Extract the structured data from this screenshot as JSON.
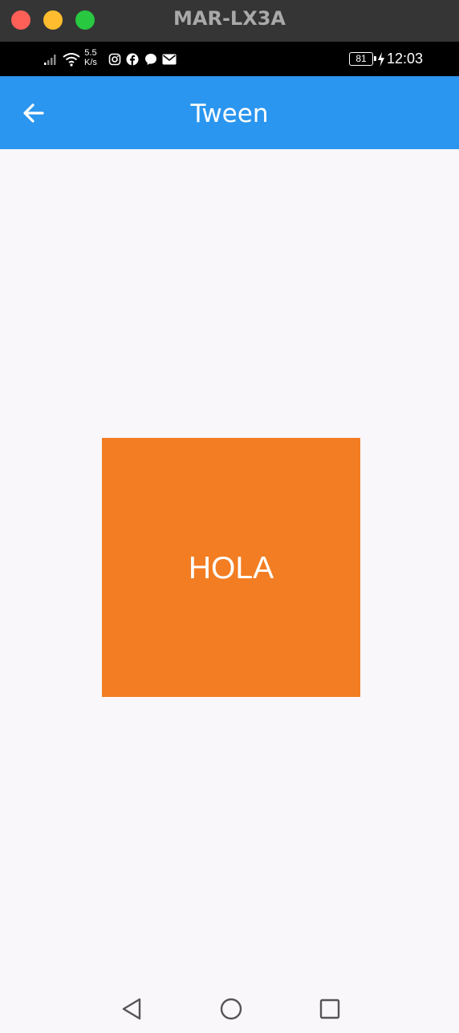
{
  "window": {
    "title": "MAR-LX3A",
    "controls": [
      "close-icon",
      "minimize-icon",
      "maximize-icon"
    ]
  },
  "status_bar": {
    "net_speed_value": "5.5",
    "net_speed_unit": "K/s",
    "battery_level": "81",
    "time": "12:03",
    "icons": [
      "signal-icon",
      "wifi-icon",
      "instagram-icon",
      "facebook-icon",
      "messenger-icon",
      "mail-icon",
      "charging-icon"
    ]
  },
  "app_bar": {
    "title": "Tween",
    "back_icon": "back-arrow-icon",
    "color": "#2b96ef"
  },
  "content": {
    "box_label": "HOLA",
    "box_color": "#f37d22"
  },
  "nav_bar": {
    "buttons": [
      "back-triangle-icon",
      "home-circle-icon",
      "recents-square-icon"
    ]
  }
}
